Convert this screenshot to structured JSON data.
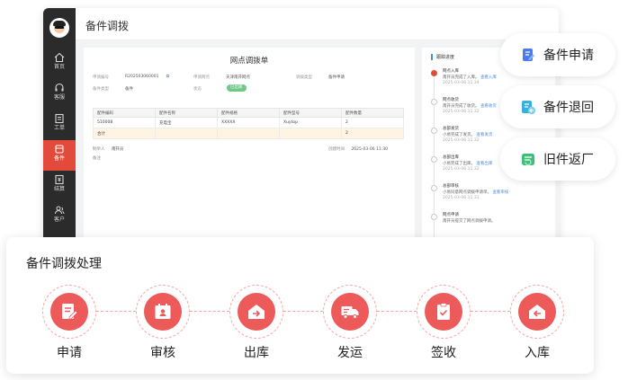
{
  "window": {
    "title": "备件调拨"
  },
  "sidebar": {
    "items": [
      {
        "label": "首页",
        "icon": "home-icon"
      },
      {
        "label": "客服",
        "icon": "headset-icon"
      },
      {
        "label": "工单",
        "icon": "ticket-icon"
      },
      {
        "label": "备件",
        "icon": "box-icon"
      },
      {
        "label": "结算",
        "icon": "settlement-icon"
      },
      {
        "label": "客户",
        "icon": "users-icon"
      }
    ],
    "active_index": 3
  },
  "document": {
    "title": "网点调拨单",
    "fields": [
      {
        "label": "申请编号",
        "value": "R202503060001"
      },
      {
        "label": "申请网点",
        "value": "天津南开网点"
      },
      {
        "label": "调拨类型",
        "value": "备件申请"
      },
      {
        "label": "备件类型",
        "value": "备件"
      },
      {
        "label": "状态",
        "value": "已出库"
      }
    ],
    "table": {
      "headers": [
        "配件编码",
        "配件名称",
        "配件规格",
        "配件型号",
        "配件数量"
      ],
      "rows": [
        [
          "510008",
          "充电宝",
          "XXXXX",
          "Xuytop",
          "2"
        ]
      ],
      "total": {
        "label": "合计",
        "value": "2"
      }
    },
    "footer": {
      "creator_label": "制单人",
      "creator": "南开员",
      "remark_label": "备注",
      "created_label": "创建时间",
      "created_time": "2025-03-06 11:30"
    }
  },
  "progress": {
    "title": "跟踪进度",
    "entries": [
      {
        "title": "网点入库",
        "desc": "南开员完成了入库。",
        "link": "查看入库",
        "time": "2025-03-06 11:34"
      },
      {
        "title": "网点收货",
        "desc": "南开员完成了收货。",
        "link": "查看收货",
        "time": "2025-03-06 11:32"
      },
      {
        "title": "总部发货",
        "desc": "小易完成了发货。",
        "link": "查看发货",
        "time": "2025-03-06 11:32"
      },
      {
        "title": "总部出库",
        "desc": "小易完成了出库。",
        "link": "查看出库",
        "time": "2025-03-06 11:32"
      },
      {
        "title": "总部审核",
        "desc": "小易同意网点调拨申请单。",
        "link": "查看审核",
        "time": "2025-03-06 11:31"
      },
      {
        "title": "网点申请",
        "desc": "南开员提交了网点调拨申请。",
        "link": "",
        "time": ""
      }
    ]
  },
  "quick_actions": [
    {
      "label": "备件申请",
      "icon": "apply-icon",
      "color": "#4a7cf0"
    },
    {
      "label": "备件退回",
      "icon": "return-icon",
      "color": "#3aaedc"
    },
    {
      "label": "旧件返厂",
      "icon": "factory-return-icon",
      "color": "#3fbf7a"
    }
  ],
  "process": {
    "title": "备件调拨处理",
    "steps": [
      {
        "label": "申请",
        "icon": "apply-form-icon"
      },
      {
        "label": "审核",
        "icon": "review-icon"
      },
      {
        "label": "出库",
        "icon": "outbound-icon"
      },
      {
        "label": "发运",
        "icon": "truck-icon"
      },
      {
        "label": "签收",
        "icon": "sign-receipt-icon"
      },
      {
        "label": "入库",
        "icon": "inbound-icon"
      }
    ],
    "accent": "#ec5a5a"
  }
}
